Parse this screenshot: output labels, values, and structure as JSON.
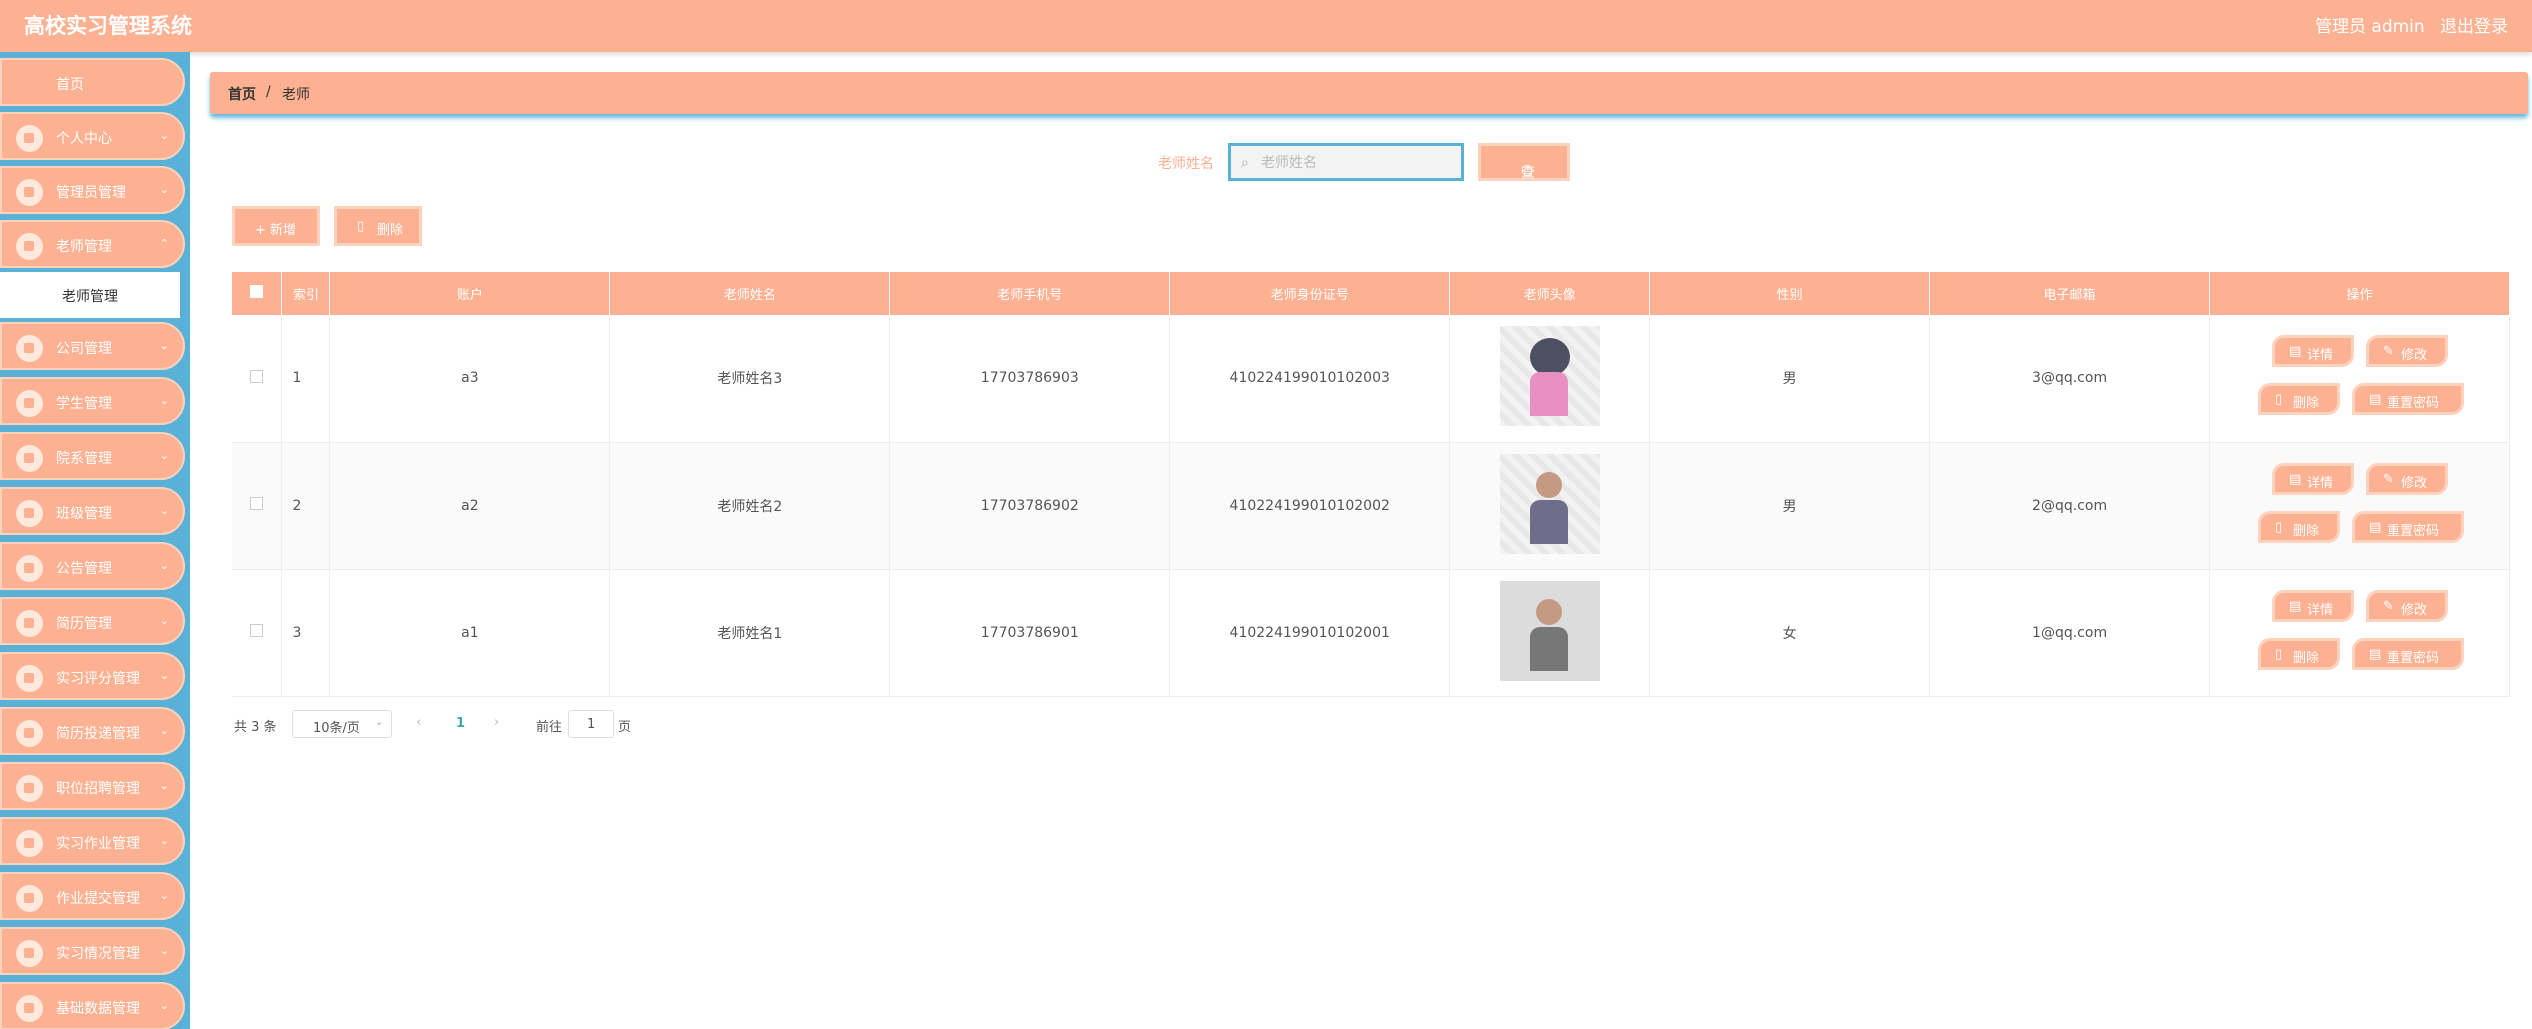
{
  "header": {
    "title": "高校实习管理系统",
    "admin": "管理员 admin",
    "logout": "退出登录"
  },
  "sidebar": {
    "home": "首页",
    "items": [
      {
        "label": "个人中心",
        "icon": "user-icon"
      },
      {
        "label": "管理员管理",
        "icon": "admin-icon"
      },
      {
        "label": "老师管理",
        "icon": "grid-icon"
      },
      {
        "label": "公司管理",
        "icon": "grid-icon"
      },
      {
        "label": "学生管理",
        "icon": "calendar-icon"
      },
      {
        "label": "院系管理",
        "icon": "list-icon"
      },
      {
        "label": "班级管理",
        "icon": "grid-icon"
      },
      {
        "label": "公告管理",
        "icon": "pin-icon"
      },
      {
        "label": "简历管理",
        "icon": "grid-icon"
      },
      {
        "label": "实习评分管理",
        "icon": "grid-icon"
      },
      {
        "label": "简历投递管理",
        "icon": "grid-icon"
      },
      {
        "label": "职位招聘管理",
        "icon": "flag-icon"
      },
      {
        "label": "实习作业管理",
        "icon": "clipboard-icon"
      },
      {
        "label": "作业提交管理",
        "icon": "grid-icon"
      },
      {
        "label": "实习情况管理",
        "icon": "grid-icon"
      },
      {
        "label": "基础数据管理",
        "icon": "grid-icon"
      }
    ],
    "active_sub": "老师管理"
  },
  "breadcrumb": {
    "home": "首页",
    "sep": "/",
    "current": "老师"
  },
  "search": {
    "label": "老师姓名",
    "placeholder": "老师姓名",
    "button": "查询"
  },
  "toolbar": {
    "add": "+ 新增",
    "delete": "删除"
  },
  "table": {
    "headers": [
      "",
      "索引",
      "账户",
      "老师姓名",
      "老师手机号",
      "老师身份证号",
      "老师头像",
      "性别",
      "电子邮箱",
      "操作"
    ],
    "rows": [
      {
        "index": "1",
        "account": "a3",
        "name": "老师姓名3",
        "phone": "17703786903",
        "idcard": "410224199010102003",
        "gender": "男",
        "email": "3@qq.com"
      },
      {
        "index": "2",
        "account": "a2",
        "name": "老师姓名2",
        "phone": "17703786902",
        "idcard": "410224199010102002",
        "gender": "男",
        "email": "2@qq.com"
      },
      {
        "index": "3",
        "account": "a1",
        "name": "老师姓名1",
        "phone": "17703786901",
        "idcard": "410224199010102001",
        "gender": "女",
        "email": "1@qq.com"
      }
    ],
    "actions": {
      "detail": "详情",
      "edit": "修改",
      "delete": "删除",
      "reset": "重置密码"
    }
  },
  "pager": {
    "total": "共 3 条",
    "size": "10条/页",
    "prev": "‹",
    "page": "1",
    "next": "›",
    "goto": "前往",
    "goto_value": "1",
    "unit": "页"
  },
  "colors": {
    "accent": "#fdb193",
    "sidebar": "#5ab1d8"
  }
}
